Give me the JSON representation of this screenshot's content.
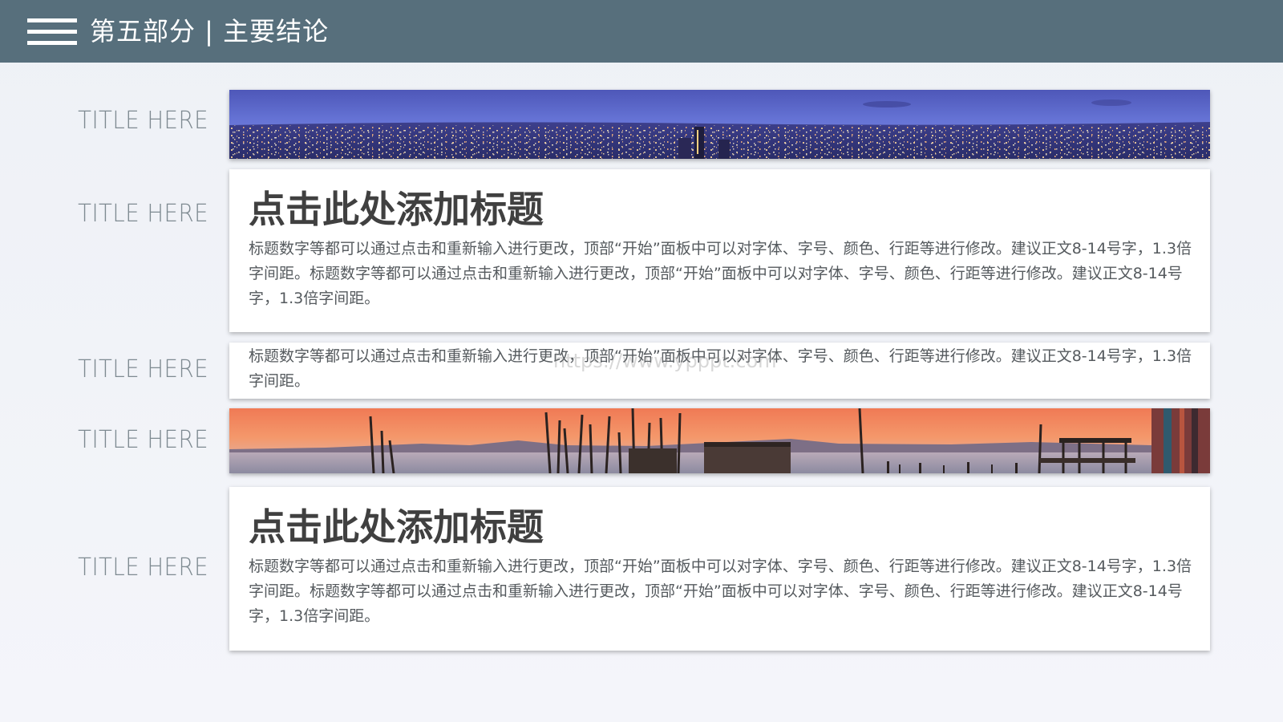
{
  "header": {
    "menu_icon": "hamburger-menu-icon",
    "title": "第五部分 | 主要结论",
    "background_color": "#576f7c"
  },
  "rows": [
    {
      "label": "TITLE HERE",
      "kind": "image",
      "image": "night-city-panorama"
    },
    {
      "label": "TITLE HERE",
      "kind": "text-card",
      "heading": "点击此处添加标题",
      "body": "标题数字等都可以通过点击和重新输入进行更改，顶部“开始”面板中可以对字体、字号、颜色、行距等进行修改。建议正文8-14号字，1.3倍字间距。标题数字等都可以通过点击和重新输入进行更改，顶部“开始”面板中可以对字体、字号、颜色、行距等进行修改。建议正文8-14号字，1.3倍字间距。"
    },
    {
      "label": "TITLE HERE",
      "kind": "text-card",
      "body": "标题数字等都可以通过点击和重新输入进行更改，顶部“开始”面板中可以对字体、字号、颜色、行距等进行修改。建议正文8-14号字，1.3倍字间距。"
    },
    {
      "label": "TITLE HERE",
      "kind": "image",
      "image": "sunset-pier-panorama"
    },
    {
      "label": "TITLE HERE",
      "kind": "text-card",
      "heading": "点击此处添加标题",
      "body": "标题数字等都可以通过点击和重新输入进行更改，顶部“开始”面板中可以对字体、字号、颜色、行距等进行修改。建议正文8-14号字，1.3倍字间距。标题数字等都可以通过点击和重新输入进行更改，顶部“开始”面板中可以对字体、字号、颜色、行距等进行修改。建议正文8-14号字，1.3倍字间距。"
    }
  ],
  "watermark": "https://www.ypppt.com",
  "colors": {
    "label_text": "#7e8a91",
    "heading_text": "#404040",
    "body_text": "#555a5e"
  }
}
